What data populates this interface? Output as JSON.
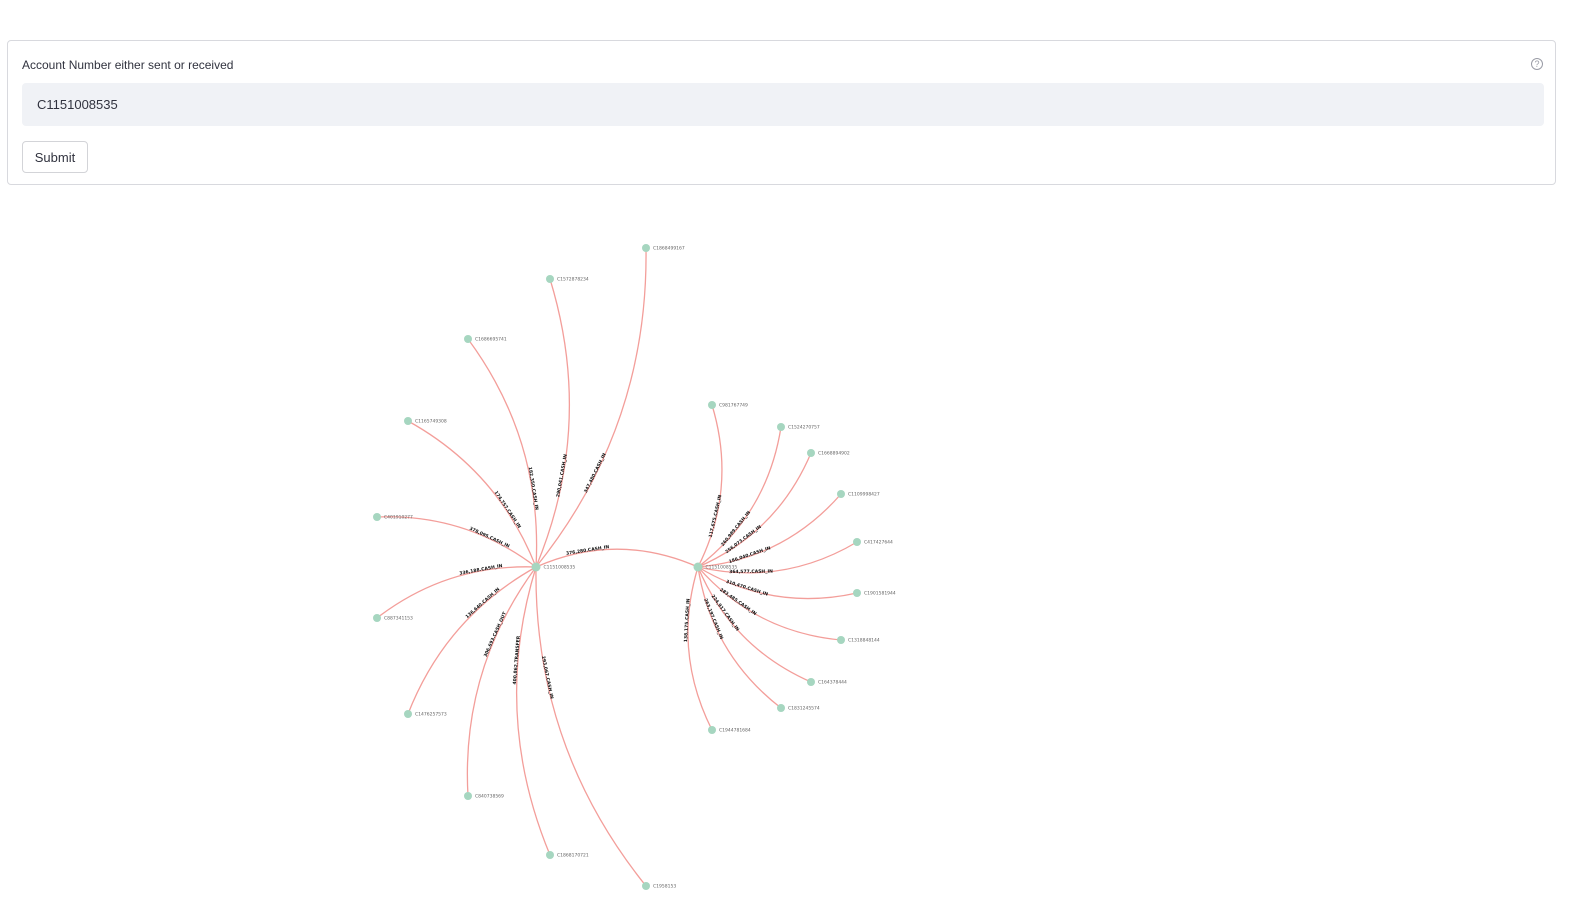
{
  "form": {
    "label": "Account Number either sent or received",
    "help_icon": "question-circle-icon",
    "input_value": "C1151008535",
    "submit_label": "Submit"
  },
  "graph": {
    "edge_color": "#f39e9a",
    "node_color": "#a6d6c0",
    "hubs": [
      {
        "id": "C1151008535"
      },
      {
        "id": "C1151008535"
      }
    ],
    "hub_edge_label": "376,280.CASH_IN",
    "left_spokes": [
      {
        "label": "C1868499167",
        "edge": "347,480.CASH_IN"
      },
      {
        "label": "C1572878234",
        "edge": "290,041.CASH_IN"
      },
      {
        "label": "C1686695741",
        "edge": "182,350.CASH_IN"
      },
      {
        "label": "C1165749308",
        "edge": "174,757.CASH_IN"
      },
      {
        "label": "C401910277",
        "edge": "378,095.CASH_IN"
      },
      {
        "label": "C887341153",
        "edge": "336,188.CASH_IN"
      },
      {
        "label": "C1476257573",
        "edge": "136,640.CASH_IN"
      },
      {
        "label": "C840738569",
        "edge": "306,693.CASH_OUT"
      },
      {
        "label": "C1868170721",
        "edge": "400,862.TRANSFER"
      },
      {
        "label": "C1958153",
        "edge": "293,067.CASH_IN"
      }
    ],
    "right_spokes": [
      {
        "label": "C981767749",
        "edge": "117,675.CASH_IN"
      },
      {
        "label": "C1524270757",
        "edge": "260,989.CASH_IN"
      },
      {
        "label": "C1668894902",
        "edge": "256,073.CASH_IN"
      },
      {
        "label": "C1109998427",
        "edge": "186,040.CASH_IN"
      },
      {
        "label": "C417427644",
        "edge": "364,577.CASH_IN"
      },
      {
        "label": "C1901581944",
        "edge": "310,470.CASH_IN"
      },
      {
        "label": "C1318848144",
        "edge": "283,485.CASH_IN"
      },
      {
        "label": "C164378444",
        "edge": "224,917.CASH_IN"
      },
      {
        "label": "C1831245574",
        "edge": "263,197.CASH_IN"
      },
      {
        "label": "C1944781684",
        "edge": "138,175.CASH_IN"
      }
    ]
  }
}
